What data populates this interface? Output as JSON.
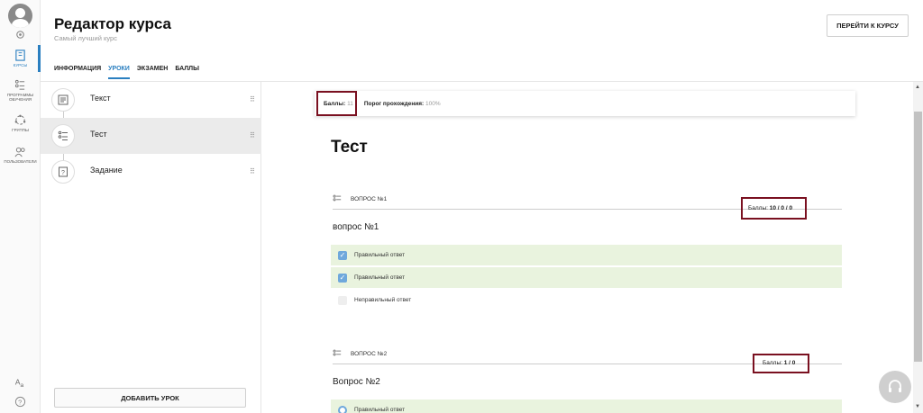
{
  "header": {
    "title": "Редактор курса",
    "subtitle": "Самый лучший курс",
    "go_button": "ПЕРЕЙТИ К КУРСУ"
  },
  "sidebar": {
    "items": [
      {
        "label": "",
        "icon": "settings-icon"
      },
      {
        "label": "КУРСЫ",
        "icon": "courses-icon"
      },
      {
        "label": "ПРОГРАММЫ ОБУЧЕНИЯ",
        "icon": "programs-icon"
      },
      {
        "label": "ГРУППЫ",
        "icon": "groups-icon"
      },
      {
        "label": "ПОЛЬЗОВАТЕЛИ",
        "icon": "users-icon"
      }
    ],
    "accent": "#2a7fc0"
  },
  "tabs": [
    "ИНФОРМАЦИЯ",
    "УРОКИ",
    "ЭКЗАМЕН",
    "БАЛЛЫ"
  ],
  "active_tab": "УРОКИ",
  "lessons": [
    {
      "label": "Текст",
      "icon": "text-lesson-icon"
    },
    {
      "label": "Тест",
      "icon": "test-lesson-icon"
    },
    {
      "label": "Задание",
      "icon": "task-lesson-icon"
    }
  ],
  "add_lesson_button": "ДОБАВИТЬ УРОК",
  "scorebar": {
    "points_label": "Баллы:",
    "points_value": "11",
    "threshold_label": "Порог прохождения:",
    "threshold_value": "100%"
  },
  "lesson_title": "Тест",
  "questions": [
    {
      "header": "ВОПРОС №1",
      "points_label": "Баллы:",
      "points_value": "10 / 0 / 0",
      "text": "вопрос №1",
      "answers": [
        {
          "text": "Правильный ответ",
          "correct": true
        },
        {
          "text": "Правильный ответ",
          "correct": true
        },
        {
          "text": "Неправильный ответ",
          "correct": false
        }
      ]
    },
    {
      "header": "ВОПРОС №2",
      "points_label": "Баллы:",
      "points_value": "1 / 0",
      "text": "Вопрос №2",
      "answers": [
        {
          "text": "Правильный ответ",
          "correct": true
        }
      ]
    }
  ],
  "colors": {
    "highlight": "#7a1020",
    "correct_bg": "#e9f3de",
    "checkbox": "#6fa8dc"
  }
}
